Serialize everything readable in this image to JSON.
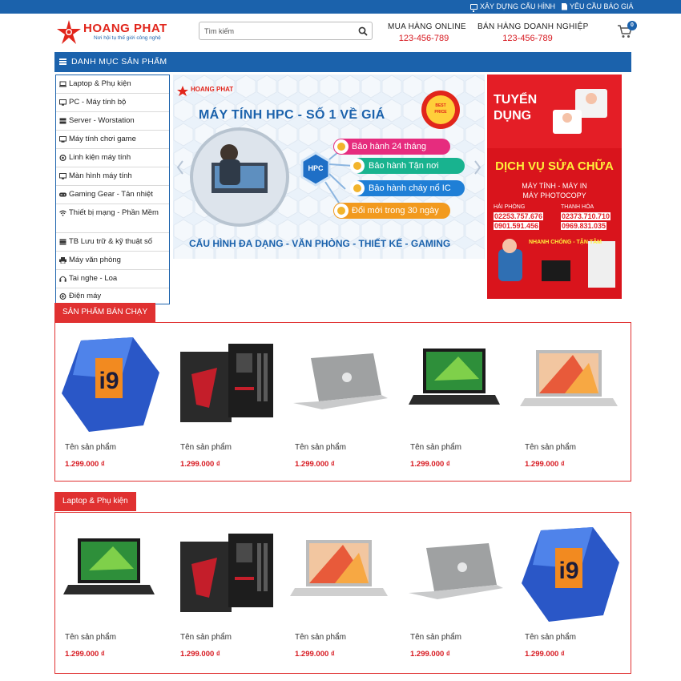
{
  "topbar": {
    "build_config": "XÂY DỰNG CẤU HÌNH",
    "request_quote": "YÊU CẦU BÁO GIÁ"
  },
  "header": {
    "brand": "HOANG PHAT",
    "slogan": "Nơi hội tụ thế giới công nghệ",
    "search_placeholder": "Tìm kiếm",
    "online": {
      "label": "MUA HÀNG ONLINE",
      "phone": "123-456-789"
    },
    "business": {
      "label": "BÁN HÀNG DOANH NGHIỆP",
      "phone": "123-456-789"
    },
    "cart_count": "0"
  },
  "category_bar": {
    "title": "DANH MỤC SẢN PHẨM"
  },
  "categories": [
    {
      "label": "Laptop & Phụ kiện",
      "icon": "laptop-icon"
    },
    {
      "label": "PC - Máy tính bộ",
      "icon": "desktop-icon"
    },
    {
      "label": "Server - Worstation",
      "icon": "server-icon"
    },
    {
      "label": "Máy tính chơi game",
      "icon": "gaming-pc-icon"
    },
    {
      "label": "Linh kiện máy tính",
      "icon": "component-icon"
    },
    {
      "label": "Màn hình máy tính",
      "icon": "monitor-icon"
    },
    {
      "label": "Gaming Gear - Tản nhiệt",
      "icon": "gamepad-icon"
    },
    {
      "label": "Thiết bị mạng - Phần Mềm",
      "icon": "wifi-icon"
    },
    {
      "label": "TB Lưu trữ & kỹ thuật số",
      "icon": "storage-icon"
    },
    {
      "label": "Máy văn phòng",
      "icon": "printer-icon"
    },
    {
      "label": "Tai nghe - Loa",
      "icon": "headphones-icon"
    },
    {
      "label": "Điện máy",
      "icon": "appliance-icon"
    }
  ],
  "slider": {
    "brand": "HOANG PHAT",
    "headline": "MÁY TÍNH HPC - SỐ 1 VỀ GIÁ",
    "badge_top": "BEST",
    "badge_bottom": "PRICE",
    "hub": "HPC",
    "benefits": [
      "Bảo hành 24 tháng",
      "Bảo hành Tận nơi",
      "Bảo hành cháy nổ IC",
      "Đổi mới trong 30 ngày"
    ],
    "footer": "CẤU HÌNH ĐA DẠNG - VĂN PHÒNG - THIẾT KẾ - GAMING",
    "colors": {
      "accent_red": "#e1251b",
      "benefit_colors": [
        "#e62c7e",
        "#18b38f",
        "#1f7fd6",
        "#f29a1e"
      ]
    }
  },
  "ad": {
    "recruit": "TUYỂN\nDỤNG",
    "service": "DỊCH VỤ SỬA CHỮA",
    "sub1": "MÁY TÍNH - MÁY IN",
    "sub2": "MÁY PHOTOCOPY",
    "city1": "HẢI PHÒNG",
    "city1_phone1": "02253.757.676",
    "city1_phone2": "0901.591.456",
    "city2": "THANH HÓA",
    "city2_phone1": "02373.710.710",
    "city2_phone2": "0969.831.035",
    "slogan": "NHANH CHÓNG - TẬN TÂM"
  },
  "sections": [
    {
      "title": "SẢN PHẨM BÁN CHẠY",
      "products": [
        {
          "name": "Tên sản phẩm",
          "price": "1.299.000 ₫",
          "image": "cpu-box"
        },
        {
          "name": "Tên sản phẩm",
          "price": "1.299.000 ₫",
          "image": "motherboard"
        },
        {
          "name": "Tên sản phẩm",
          "price": "1.299.000 ₫",
          "image": "laptop-silver"
        },
        {
          "name": "Tên sản phẩm",
          "price": "1.299.000 ₫",
          "image": "laptop-black"
        },
        {
          "name": "Tên sản phẩm",
          "price": "1.299.000 ₫",
          "image": "laptop-colorful"
        }
      ]
    },
    {
      "title": "Laptop & Phụ kiện",
      "products": [
        {
          "name": "Tên sản phẩm",
          "price": "1.299.000 ₫",
          "image": "laptop-black"
        },
        {
          "name": "Tên sản phẩm",
          "price": "1.299.000 ₫",
          "image": "motherboard"
        },
        {
          "name": "Tên sản phẩm",
          "price": "1.299.000 ₫",
          "image": "laptop-colorful"
        },
        {
          "name": "Tên sản phẩm",
          "price": "1.299.000 ₫",
          "image": "laptop-silver"
        },
        {
          "name": "Tên sản phẩm",
          "price": "1.299.000 ₫",
          "image": "cpu-box"
        }
      ]
    }
  ],
  "theme": {
    "primary": "#1b62ac",
    "accent": "#e03131",
    "price": "#d71920"
  }
}
